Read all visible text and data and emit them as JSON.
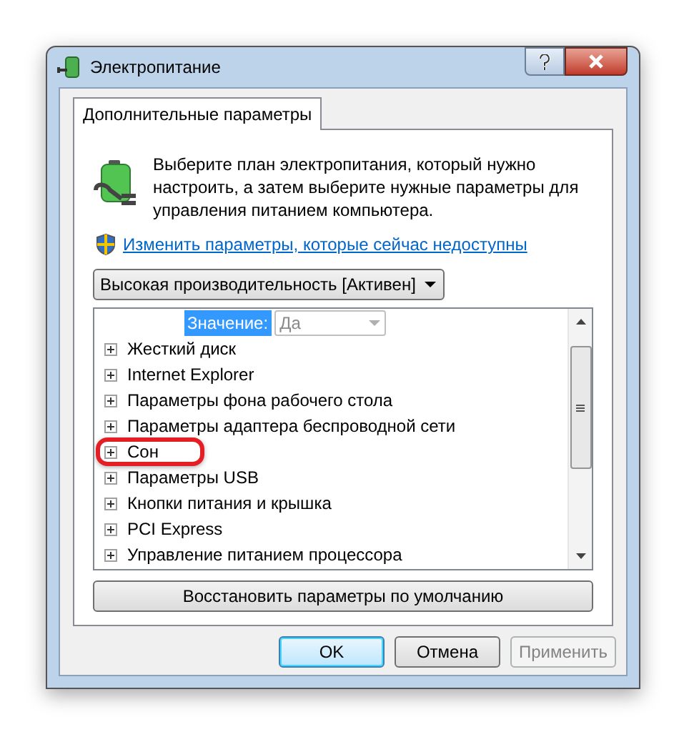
{
  "window": {
    "title": "Электропитание"
  },
  "tabs": [
    {
      "label": "Дополнительные параметры",
      "selected": true
    }
  ],
  "intro": "Выберите план электропитания, который нужно настроить, а затем выберите нужные параметры для управления питанием компьютера.",
  "link": "Изменить параметры, которые сейчас недоступны",
  "plan_dropdown": {
    "value": "Высокая производительность [Активен]"
  },
  "value_row": {
    "label": "Значение:",
    "value": "Да",
    "disabled": true
  },
  "tree": [
    {
      "label": "Жесткий диск",
      "expanded": false,
      "highlighted": false
    },
    {
      "label": "Internet Explorer",
      "expanded": false,
      "highlighted": false
    },
    {
      "label": "Параметры фона рабочего стола",
      "expanded": false,
      "highlighted": false
    },
    {
      "label": "Параметры адаптера беспроводной сети",
      "expanded": false,
      "highlighted": false
    },
    {
      "label": "Сон",
      "expanded": false,
      "highlighted": true
    },
    {
      "label": "Параметры USB",
      "expanded": false,
      "highlighted": false
    },
    {
      "label": "Кнопки питания и крышка",
      "expanded": false,
      "highlighted": false
    },
    {
      "label": "PCI Express",
      "expanded": false,
      "highlighted": false
    },
    {
      "label": "Управление питанием процессора",
      "expanded": false,
      "highlighted": false
    }
  ],
  "restore_button": "Восстановить параметры по умолчанию",
  "buttons": [
    {
      "label": "OK",
      "default": true,
      "disabled": false
    },
    {
      "label": "Отмена",
      "default": false,
      "disabled": false
    },
    {
      "label": "Применить",
      "default": false,
      "disabled": true
    }
  ]
}
